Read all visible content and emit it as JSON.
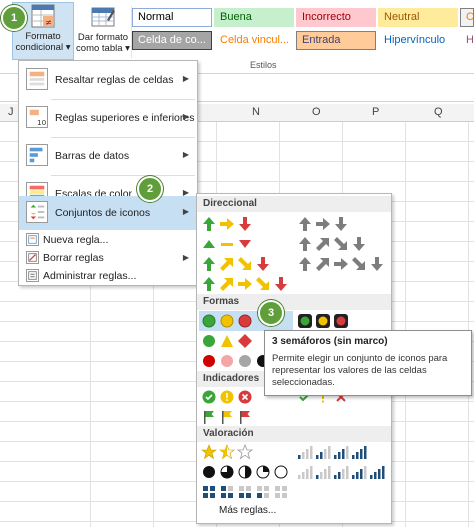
{
  "ribbon": {
    "formato_condicional": {
      "line1": "Formato",
      "line2": "condicional ▾"
    },
    "dar_formato": {
      "line1": "Dar formato",
      "line2": "como tabla ▾"
    },
    "styles_caption": "Estilos",
    "styles": [
      {
        "label": "Normal",
        "bg": "#ffffff",
        "fg": "#000000",
        "border": "#8faadc"
      },
      {
        "label": "Buena",
        "bg": "#c6efce",
        "fg": "#006100",
        "border": "#c6efce"
      },
      {
        "label": "Incorrecto",
        "bg": "#ffc7ce",
        "fg": "#9c0006",
        "border": "#ffc7ce"
      },
      {
        "label": "Neutral",
        "bg": "#ffeb9c",
        "fg": "#9c5700",
        "border": "#ffeb9c"
      },
      {
        "label": "Cál",
        "bg": "#f2f2f2",
        "fg": "#fa7d00",
        "border": "#7f7f7f"
      },
      {
        "label": "Celda de co...",
        "bg": "#a5a5a5",
        "fg": "#ffffff",
        "border": "#3f3f3f"
      },
      {
        "label": "Celda vincul...",
        "bg": "#ffffff",
        "fg": "#fa7d00",
        "border": "#ffffff"
      },
      {
        "label": "Entrada",
        "bg": "#ffcc99",
        "fg": "#3f3f76",
        "border": "#7f7f7f"
      },
      {
        "label": "Hipervínculo",
        "bg": "#ffffff",
        "fg": "#0563c1",
        "border": "#ffffff"
      },
      {
        "label": "Hip",
        "bg": "#ffffff",
        "fg": "#954f72",
        "border": "#ffffff"
      }
    ]
  },
  "columns": [
    "J",
    "N",
    "O",
    "P",
    "Q"
  ],
  "menu": {
    "items": [
      {
        "label": "Resaltar reglas de celdas",
        "arrow": "▶"
      },
      {
        "label": "Reglas superiores e inferiores",
        "arrow": "▶"
      },
      {
        "label": "Barras de datos",
        "arrow": "▶"
      },
      {
        "label": "Escalas de color",
        "arrow": "▶"
      },
      {
        "label": "Conjuntos de iconos",
        "arrow": "▶"
      }
    ],
    "small_items": [
      {
        "label": "Nueva regla...",
        "arrow": ""
      },
      {
        "label": "Borrar reglas",
        "arrow": "▶"
      },
      {
        "label": "Administrar reglas...",
        "arrow": ""
      }
    ]
  },
  "submenu": {
    "sections": [
      "Direccional",
      "Formas",
      "Indicadores",
      "Valoración"
    ],
    "more": "Más reglas..."
  },
  "tooltip": {
    "title": "3 semáforos (sin marco)",
    "text": "Permite elegir un conjunto de iconos para representar los valores de las celdas seleccionadas."
  },
  "badges": [
    "1",
    "2",
    "3"
  ],
  "colors": {
    "accent_selected": "#c7dff3",
    "badge_green": "#5f9e3a",
    "icon_green": "#3aa63a",
    "icon_yellow": "#f2c200",
    "icon_red": "#d83b3b",
    "icon_gray": "#7d7d7d"
  }
}
